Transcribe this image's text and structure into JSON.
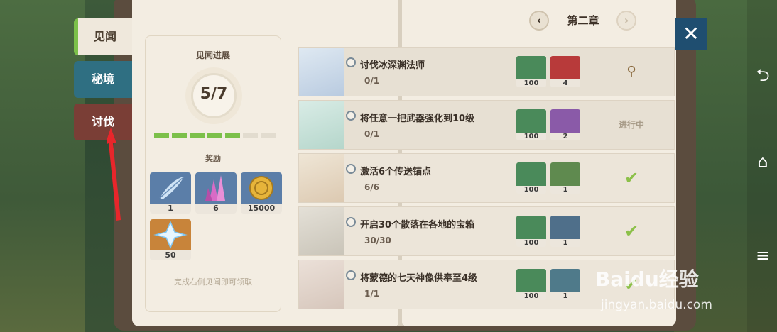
{
  "tabs": {
    "jianwen": "见闻",
    "mijing": "秘境",
    "taofa": "讨伐"
  },
  "chapter": {
    "title": "第二章",
    "prev": "‹",
    "next": "›"
  },
  "close_label": "✕",
  "progress": {
    "title": "见闻进展",
    "value": "5/7",
    "filled": 5,
    "total": 7,
    "reward_title": "奖励",
    "rewards": [
      {
        "icon": "feather-icon",
        "count": "1"
      },
      {
        "icon": "crystal-icon",
        "count": "6"
      },
      {
        "icon": "mora-coin-icon",
        "count": "15000"
      },
      {
        "icon": "primogem-icon",
        "count": "50"
      }
    ],
    "hint": "完成右侧见闻即可领取"
  },
  "quests": [
    {
      "title": "讨伐冰深渊法师",
      "count": "0/1",
      "items": [
        "100",
        "4"
      ],
      "status_type": "pin",
      "status": "⚲"
    },
    {
      "title": "将任意一把武器强化到10级",
      "count": "0/1",
      "items": [
        "100",
        "2"
      ],
      "status_type": "text",
      "status": "进行中"
    },
    {
      "title": "激活6个传送锚点",
      "count": "6/6",
      "items": [
        "100",
        "1"
      ],
      "status_type": "done",
      "status": "✔"
    },
    {
      "title": "开启30个散落在各地的宝箱",
      "count": "30/30",
      "items": [
        "100",
        "1"
      ],
      "status_type": "done",
      "status": "✔"
    },
    {
      "title": "将蒙德的七天神像供奉至4级",
      "count": "1/1",
      "items": [
        "100",
        "1"
      ],
      "status_type": "done",
      "status": "✔"
    }
  ],
  "watermark": {
    "brand": "Baidu经验",
    "url": "jingyan.baidu.com"
  }
}
